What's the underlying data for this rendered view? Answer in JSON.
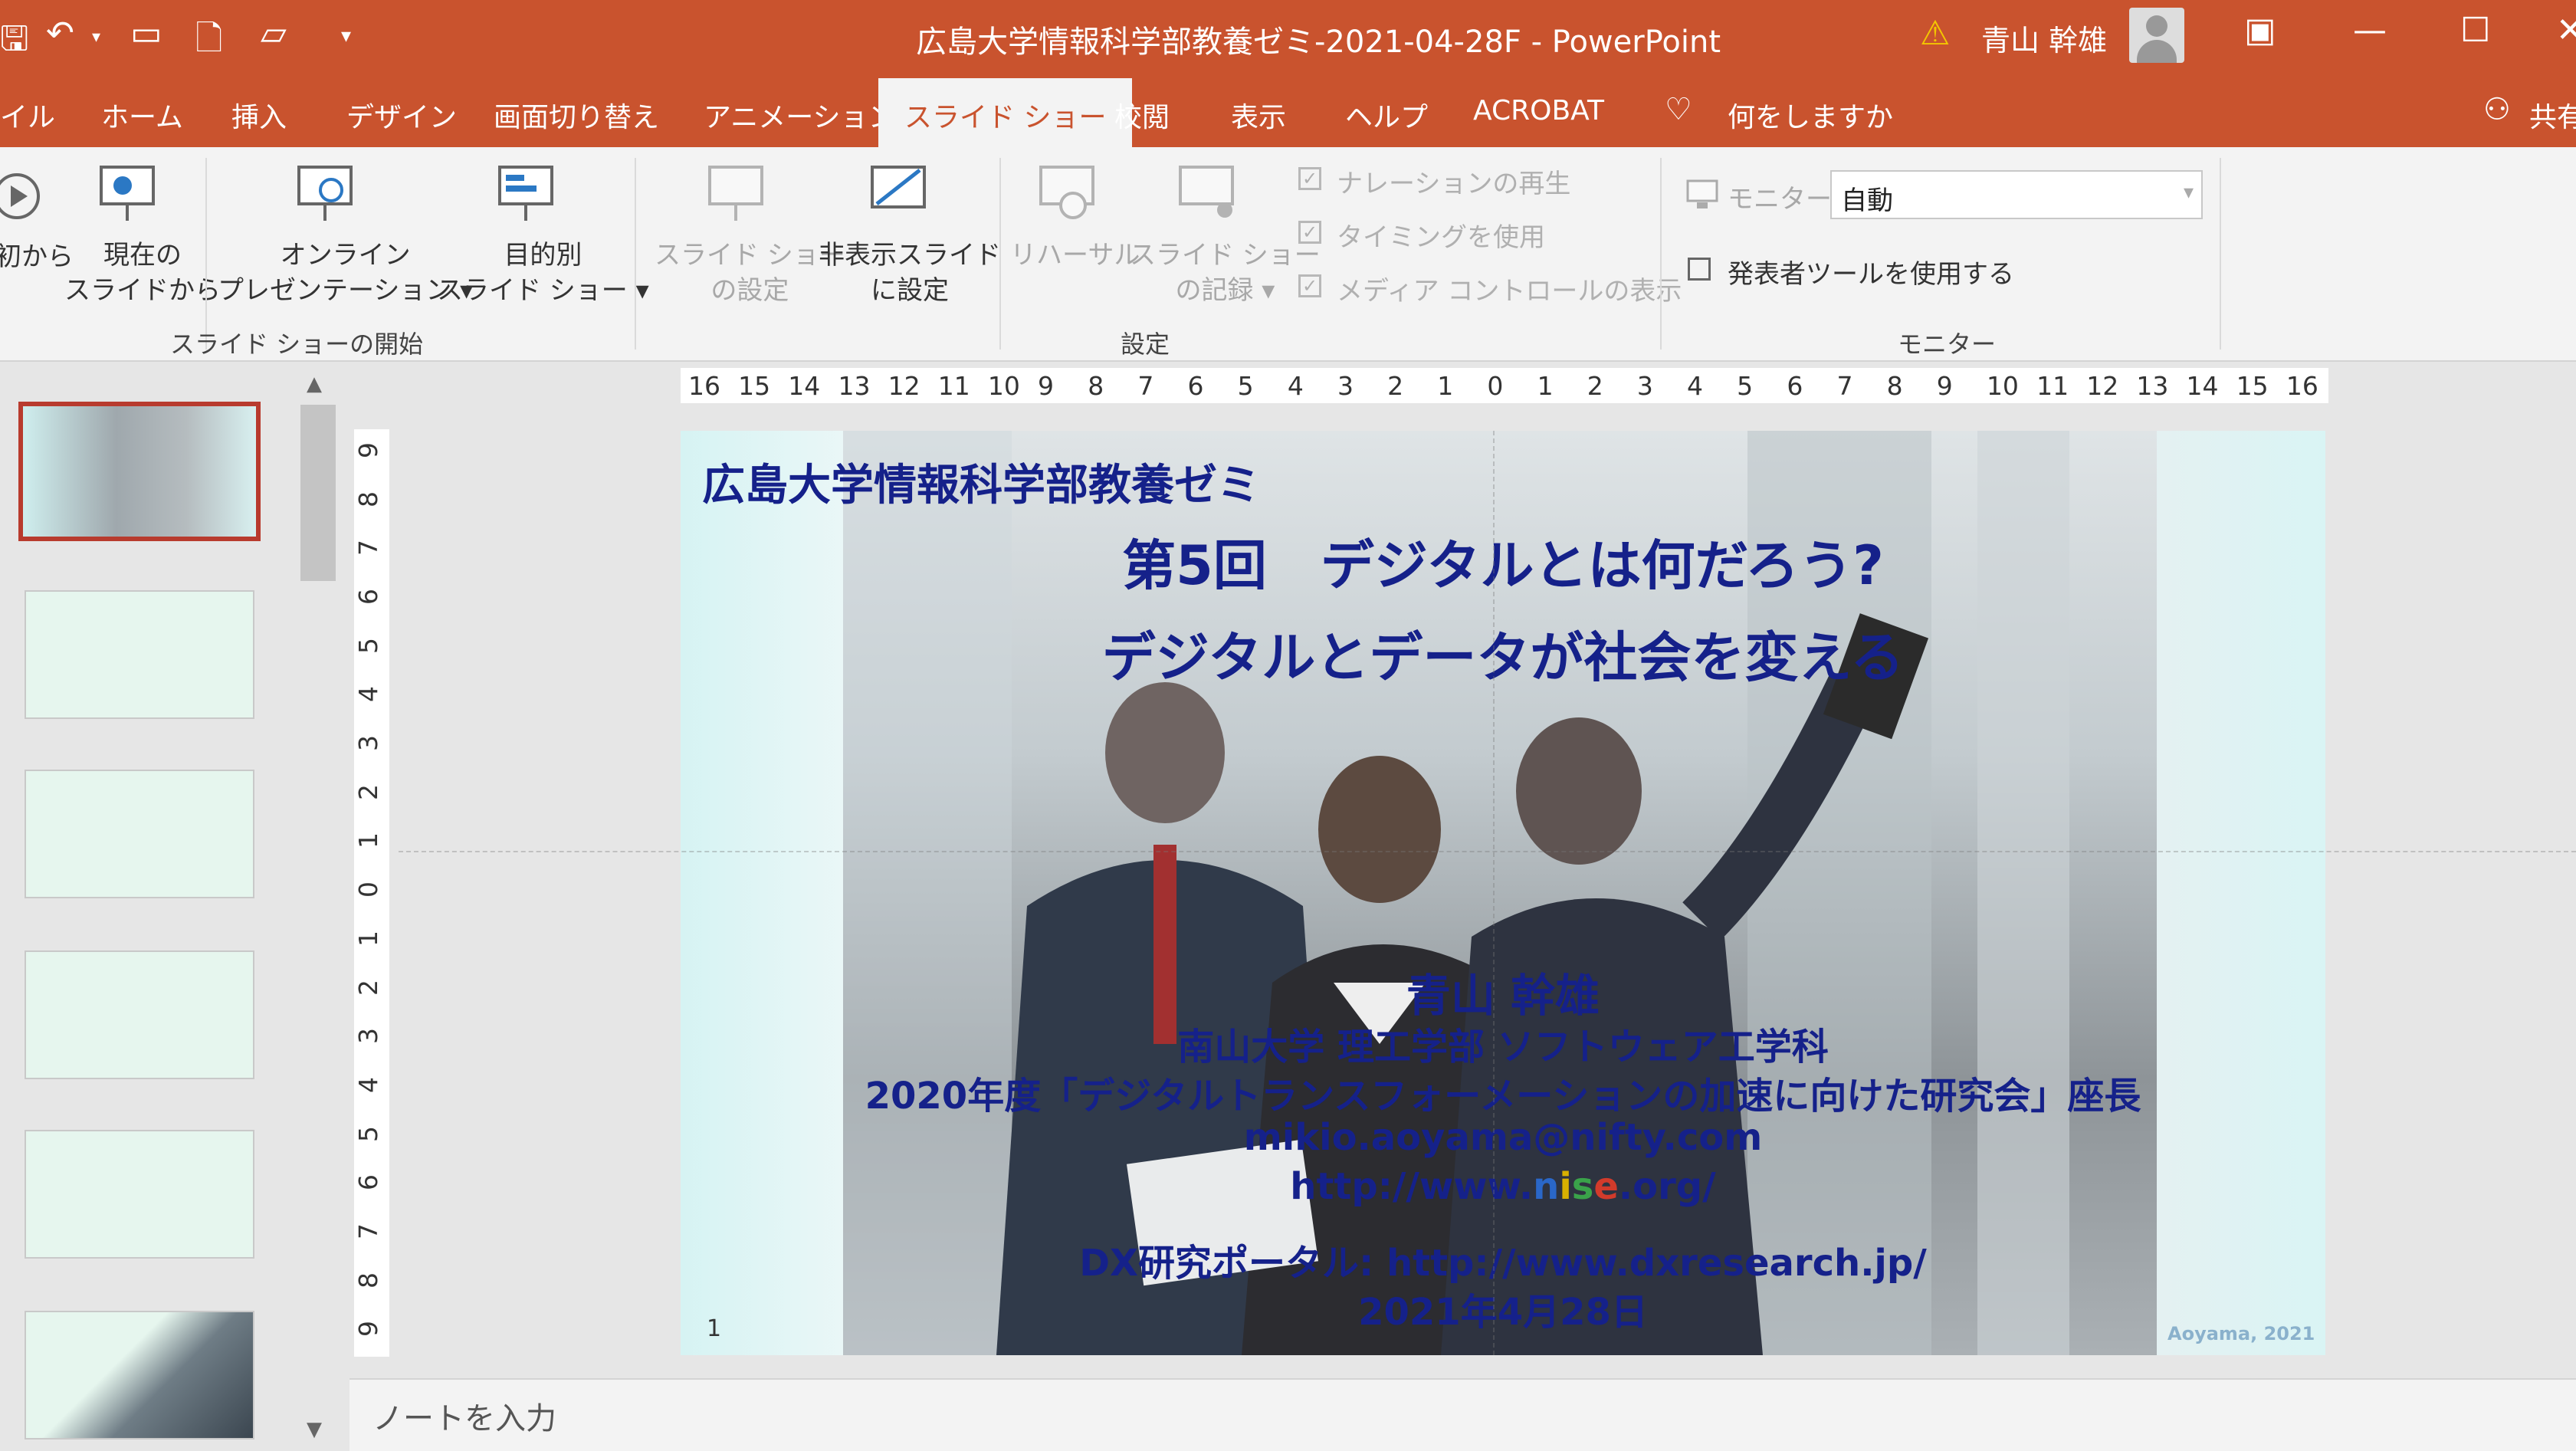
{
  "titlebar": {
    "title": "広島大学情報科学部教養ゼミ-2021-04-28F  -  PowerPoint",
    "user": "青山 幹雄",
    "qat_icons": [
      "save-icon",
      "undo-icon",
      "start-slideshow-icon",
      "print-preview-icon",
      "open-icon",
      "customize-qat-icon"
    ]
  },
  "tabs": [
    "イル",
    "ホーム",
    "挿入",
    "デザイン",
    "画面切り替え",
    "アニメーション",
    "スライド ショー",
    "校閲",
    "表示",
    "ヘルプ",
    "ACROBAT"
  ],
  "active_tab": "スライド ショー",
  "tell_me": "何をしますか",
  "share": "共有",
  "ribbon": {
    "start": {
      "from_beginning": "初から",
      "from_current": [
        "現在の",
        "スライドから"
      ],
      "online": [
        "オンライン",
        "プレゼンテーション ▾"
      ],
      "custom": [
        "目的別",
        "スライド ショー ▾"
      ],
      "group_label": "スライド ショーの開始"
    },
    "setup": {
      "setup_show": [
        "スライド ショー",
        "の設定"
      ],
      "hide_slide": [
        "非表示スライド",
        "に設定"
      ],
      "rehearse": "リハーサル",
      "record": [
        "スライド ショー",
        "の記録 ▾"
      ],
      "play_narration": "ナレーションの再生",
      "use_timings": "タイミングを使用",
      "show_media_controls": "メディア コントロールの表示",
      "group_label": "設定"
    },
    "monitors": {
      "monitor_label": "モニター:",
      "monitor_value": "自動",
      "presenter_view": "発表者ツールを使用する",
      "group_label": "モニター"
    }
  },
  "ruler": {
    "horizontal": [
      "16",
      "15",
      "14",
      "13",
      "12",
      "11",
      "10",
      "9",
      "8",
      "7",
      "6",
      "5",
      "4",
      "3",
      "2",
      "1",
      "0",
      "1",
      "2",
      "3",
      "4",
      "5",
      "6",
      "7",
      "8",
      "9",
      "10",
      "11",
      "12",
      "13",
      "14",
      "15",
      "16"
    ],
    "vertical": [
      "9",
      "8",
      "7",
      "6",
      "5",
      "4",
      "3",
      "2",
      "1",
      "0",
      "1",
      "2",
      "3",
      "4",
      "5",
      "6",
      "7",
      "8",
      "9"
    ]
  },
  "slide": {
    "header": "広島大学情報科学部教養ゼミ",
    "title1": "第5回　デジタルとは何だろう?",
    "title2": "デジタルとデータが社会を変える",
    "author": "青山 幹雄",
    "affiliation": "南山大学  理工学部 ソフトウェア工学科",
    "role": "2020年度「デジタルトランスフォーメーションの加速に向けた研究会」座長",
    "email": "mikio.aoyama@nifty.com",
    "url_prefix": "http://www.",
    "url_n": "n",
    "url_i": "i",
    "url_s": "s",
    "url_e": "e",
    "url_suffix": ".org/",
    "portal": "DX研究ポータル: http://www.dxresearch.jp/",
    "date": "2021年4月28日",
    "page_number": "1",
    "copyright": "Aoyama, 2021"
  },
  "notes_placeholder": "ノートを入力",
  "colors": {
    "accent": "#c9532e",
    "slide_text": "#15218a",
    "url_n": "#2a67c8",
    "url_i": "#d8b000",
    "url_s": "#3aa34a",
    "url_e": "#d23b2b"
  }
}
